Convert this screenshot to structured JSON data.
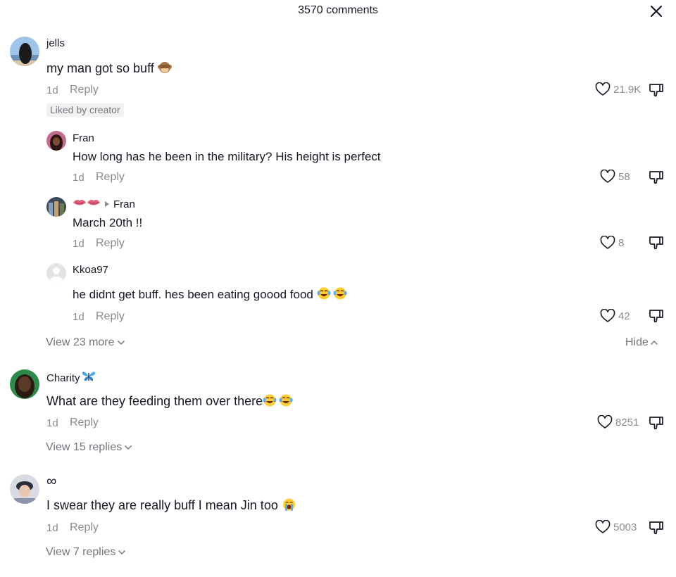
{
  "header": {
    "title": "3570 comments"
  },
  "comments": [
    {
      "username": "jells",
      "text": "my man got so buff",
      "time": "1d",
      "reply_label": "Reply",
      "badge": "Liked by creator",
      "likes": "21.9K",
      "replies": [
        {
          "username": "Fran",
          "text": "How long has he been in the military? His height is perfect",
          "time": "1d",
          "reply_label": "Reply",
          "likes": "58"
        },
        {
          "username": "",
          "reply_to": "Fran",
          "text": "March 20th !!",
          "time": "1d",
          "reply_label": "Reply",
          "likes": "8"
        },
        {
          "username": "Kkoa97",
          "text": "he didnt get buff. hes been eating goood food",
          "time": "1d",
          "reply_label": "Reply",
          "likes": "42"
        }
      ],
      "view_more": "View 23 more",
      "hide_label": "Hide"
    },
    {
      "username": "Charity",
      "text": "What are they feeding them over there",
      "time": "1d",
      "reply_label": "Reply",
      "likes": "8251",
      "view_replies": "View 15 replies"
    },
    {
      "username": "∞",
      "text": "I swear they are really buff I mean Jin too",
      "time": "1d",
      "reply_label": "Reply",
      "likes": "5003",
      "view_replies": "View 7 replies"
    }
  ],
  "icons": {
    "close": "close-icon",
    "like": "heart-outline-icon",
    "dislike": "thumbs-down-icon",
    "chevron_down": "chevron-down-icon",
    "chevron_up": "chevron-up-icon"
  }
}
